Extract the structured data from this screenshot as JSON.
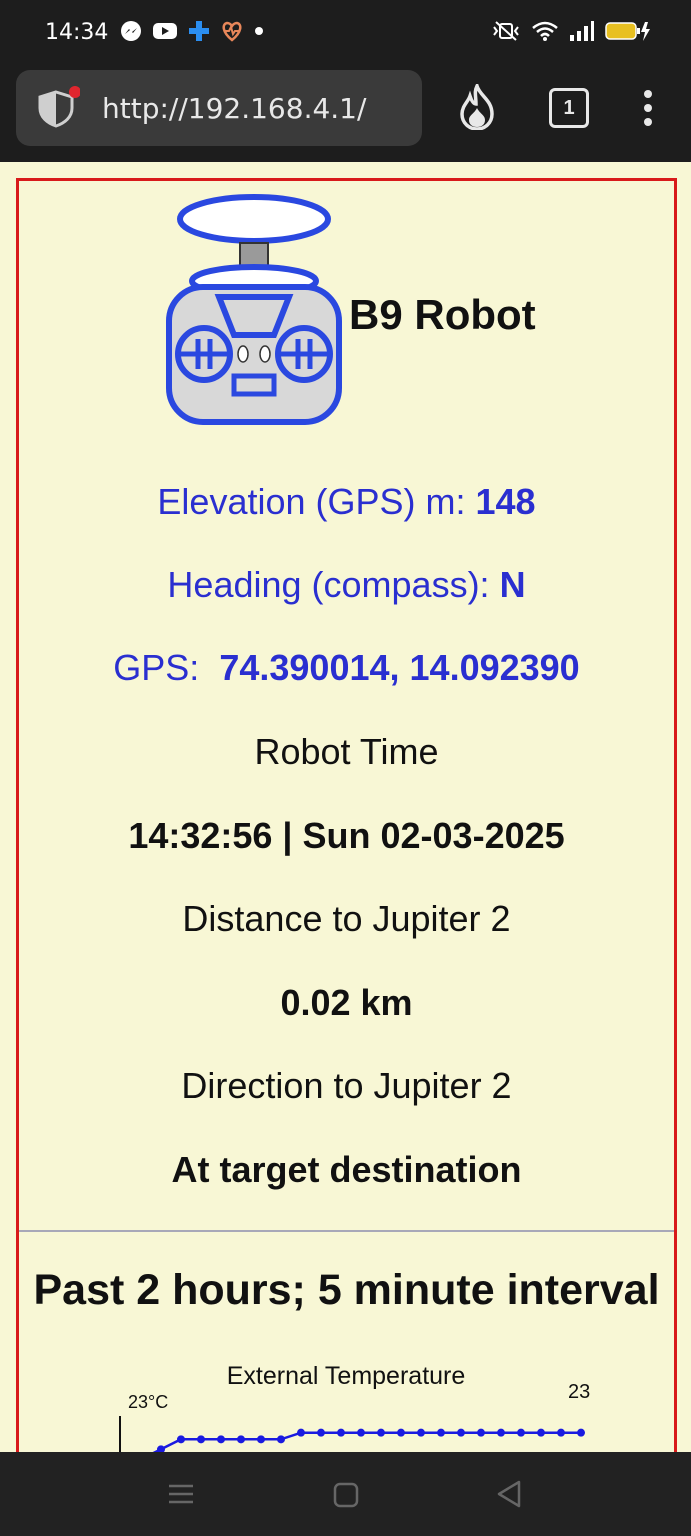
{
  "status_bar": {
    "time": "14:34",
    "icons_left": [
      "messenger-icon",
      "youtube-icon",
      "plus-icon",
      "heart-pulse-icon",
      "dot-icon"
    ],
    "icons_right": [
      "mute-vibrate-icon",
      "wifi-icon",
      "signal-icon",
      "battery-charging-icon"
    ]
  },
  "browser": {
    "url": "http://192.168.4.1/",
    "tab_count": "1"
  },
  "header": {
    "title": "B9 Robot"
  },
  "readings": {
    "elevation_label": "Elevation (GPS) m:",
    "elevation_value": "148",
    "heading_label": "Heading (compass):",
    "heading_value": "N",
    "gps_label": "GPS:",
    "gps_lat": "74.390014,",
    "gps_lon": "14.092390",
    "robot_time_label": "Robot Time",
    "robot_time_value": "14:32:56 | Sun 02-03-2025",
    "distance_label": "Distance to Jupiter 2",
    "distance_value": "0.02 km",
    "direction_label": "Direction to Jupiter 2",
    "direction_value": "At target destination"
  },
  "history": {
    "title": "Past 2 hours; 5 minute interval"
  },
  "chart_data": {
    "type": "line",
    "title": "External Temperature",
    "ylabel": "23°C",
    "last_value_label": "23",
    "series": [
      {
        "values": [
          22.0,
          22.0,
          22.3,
          22.6,
          22.6,
          22.6,
          22.6,
          22.6,
          22.6,
          22.8,
          22.8,
          22.8,
          22.8,
          22.8,
          22.8,
          22.8,
          22.8,
          22.8,
          22.8,
          22.8,
          22.8,
          22.8,
          22.8,
          22.8
        ]
      }
    ],
    "ylim": [
      21.5,
      23.3
    ]
  }
}
